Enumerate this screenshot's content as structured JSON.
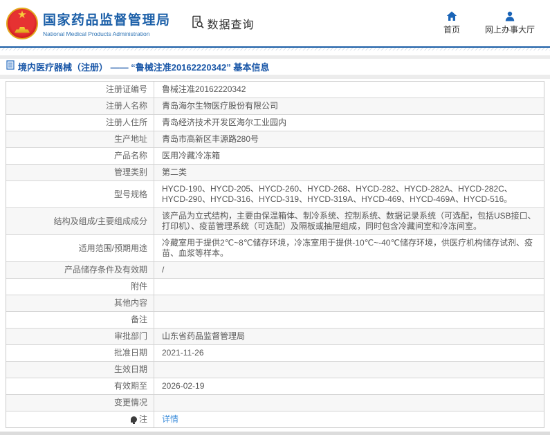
{
  "header": {
    "logo": {
      "emblem": "china-national-emblem",
      "title": "国家药品监督管理局",
      "subtitle": "National Medical Products Administration"
    },
    "section_label": "数据查询",
    "nav": [
      {
        "icon": "home-icon",
        "label": "首页"
      },
      {
        "icon": "person-icon",
        "label": "网上办事大厅"
      }
    ]
  },
  "page_title": {
    "icon": "document-icon",
    "text": "境内医疗器械（注册） —— “鲁械注准20162220342” 基本信息"
  },
  "table": {
    "rows": [
      {
        "label": "注册证编号",
        "value": "鲁械注准20162220342"
      },
      {
        "label": "注册人名称",
        "value": "青岛海尔生物医疗股份有限公司"
      },
      {
        "label": "注册人住所",
        "value": "青岛经济技术开发区海尔工业园内"
      },
      {
        "label": "生产地址",
        "value": "青岛市高新区丰源路280号"
      },
      {
        "label": "产品名称",
        "value": "医用冷藏冷冻箱"
      },
      {
        "label": "管理类别",
        "value": "第二类"
      },
      {
        "label": "型号规格",
        "value": "HYCD-190、HYCD-205、HYCD-260、HYCD-268、HYCD-282、HYCD-282A、HYCD-282C、HYCD-290、HYCD-316、HYCD-319、HYCD-319A、HYCD-469、HYCD-469A、HYCD-516。"
      },
      {
        "label": "结构及组成/主要组成成分",
        "value": "该产品为立式结构，主要由保温箱体、制冷系统、控制系统、数据记录系统（可选配，包括USB接口、打印机）、疫苗管理系统（可选配）及隔板或抽屉组成，同时包含冷藏间室和冷冻间室。"
      },
      {
        "label": "适用范围/预期用途",
        "value": "冷藏室用于提供2℃~8℃储存环境，冷冻室用于提供-10℃~-40℃储存环境，供医疗机构储存试剂、疫苗、血浆等样本。"
      },
      {
        "label": "产品储存条件及有效期",
        "value": "/"
      },
      {
        "label": "附件",
        "value": ""
      },
      {
        "label": "其他内容",
        "value": ""
      },
      {
        "label": "备注",
        "value": ""
      },
      {
        "label": "审批部门",
        "value": "山东省药品监督管理局"
      },
      {
        "label": "批准日期",
        "value": "2021-11-26"
      },
      {
        "label": "生效日期",
        "value": ""
      },
      {
        "label": "有效期至",
        "value": "2026-02-19"
      },
      {
        "label": "变更情况",
        "value": ""
      },
      {
        "label": "注",
        "label_icon": "note-icon",
        "value": "详情",
        "link": true
      }
    ]
  },
  "colors": {
    "brand_blue": "#1b5fa8",
    "accent_blue": "#1a64b7",
    "header_line_blue": "#1a5da5",
    "link_blue": "#3c8ddb",
    "emblem_red": "#d42020",
    "emblem_gold": "#f0c030",
    "border_gray": "#d4d4d4",
    "alt_row_bg": "#f7f7f7"
  }
}
